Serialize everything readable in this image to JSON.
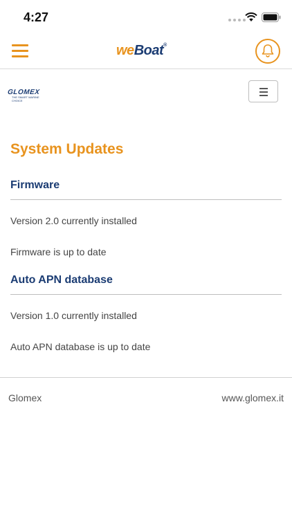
{
  "status_bar": {
    "time": "4:27",
    "signal_icon": "cellular-signal-icon",
    "wifi_icon": "wifi-icon",
    "battery_icon": "battery-icon"
  },
  "header": {
    "menu_icon": "hamburger-menu-icon",
    "logo": {
      "we": "we",
      "boat": "Boat",
      "reg": "®"
    },
    "bell_icon": "bell-icon"
  },
  "brand": {
    "name": "GLOMEX",
    "tagline": "THE SMART MARINE CHOICE",
    "toggle_icon": "menu-toggle-icon"
  },
  "content": {
    "title": "System Updates",
    "sections": [
      {
        "heading": "Firmware",
        "lines": [
          "Version 2.0 currently installed",
          "Firmware is up to date"
        ]
      },
      {
        "heading": "Auto APN database",
        "lines": [
          "Version 1.0 currently installed",
          "Auto APN database is up to date"
        ]
      }
    ]
  },
  "footer": {
    "left": "Glomex",
    "right": "www.glomex.it"
  },
  "colors": {
    "accent_orange": "#e8931e",
    "heading_navy": "#1b3c73",
    "divider_gray": "#bdbdbd"
  }
}
